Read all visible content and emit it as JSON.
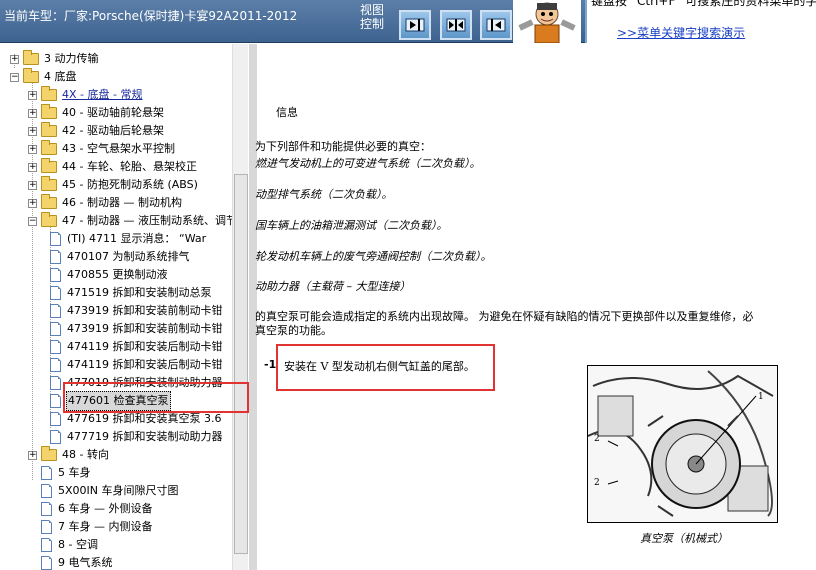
{
  "header": {
    "car_label": "当前车型：厂家:Porsche(保时捷)卡宴92A2011-2012",
    "view_control_label": "视图控制",
    "nav_buttons": [
      "show-tree",
      "split-view",
      "show-content"
    ]
  },
  "hint": {
    "text": "键盘按 “Ctrl+F” 可搜索庄的资料菜单的字！",
    "link": ">>菜单关键字搜索演示"
  },
  "tree": {
    "items": [
      {
        "label": "3 动力传输",
        "kind": "folder",
        "expander": "+"
      },
      {
        "label": "4 底盘",
        "kind": "folder",
        "expander": "−"
      },
      {
        "label": "4X - 底盘 - 常规",
        "kind": "folder",
        "expander": "+"
      },
      {
        "label": "40 - 驱动轴前轮悬架",
        "kind": "folder",
        "expander": "+"
      },
      {
        "label": "42 - 驱动轴后轮悬架",
        "kind": "folder",
        "expander": "+"
      },
      {
        "label": "43 - 空气悬架水平控制",
        "kind": "folder",
        "expander": "+"
      },
      {
        "label": "44 - 车轮、轮胎、悬架校正",
        "kind": "folder",
        "expander": "+"
      },
      {
        "label": "45 - 防抱死制动系统 (ABS)",
        "kind": "folder",
        "expander": "+"
      },
      {
        "label": "46 - 制动器 — 制动机构",
        "kind": "folder",
        "expander": "+"
      },
      {
        "label": "47 - 制动器 — 液压制动系统、调节",
        "kind": "folder",
        "expander": "−"
      },
      {
        "label": "(TI) 4711 显示消息： “War",
        "kind": "doc"
      },
      {
        "label": "470107 为制动系统排气",
        "kind": "doc"
      },
      {
        "label": "470855 更换制动液",
        "kind": "doc"
      },
      {
        "label": "471519 拆卸和安装制动总泵",
        "kind": "doc"
      },
      {
        "label": "473919 拆卸和安装前制动卡钳",
        "kind": "doc"
      },
      {
        "label": "473919 拆卸和安装前制动卡钳",
        "kind": "doc"
      },
      {
        "label": "474119 拆卸和安装后制动卡钳",
        "kind": "doc"
      },
      {
        "label": "474119 拆卸和安装后制动卡钳",
        "kind": "doc"
      },
      {
        "label": "477019 拆卸和安装制动助力器",
        "kind": "doc"
      },
      {
        "label": "477601 检查真空泵",
        "kind": "doc"
      },
      {
        "label": "477619 拆卸和安装真空泵 3.6",
        "kind": "doc"
      },
      {
        "label": "477719 拆卸和安装制动助力器",
        "kind": "doc"
      },
      {
        "label": "48 - 转向",
        "kind": "folder",
        "expander": "+"
      },
      {
        "label": "5 车身",
        "kind": "doc"
      },
      {
        "label": "5X00IN 车身间隙尺寸图",
        "kind": "doc"
      },
      {
        "label": "6 车身 — 外侧设备",
        "kind": "doc"
      },
      {
        "label": "7 车身 — 内侧设备",
        "kind": "doc"
      },
      {
        "label": "8 - 空调",
        "kind": "doc"
      },
      {
        "label": "9 电气系统",
        "kind": "doc"
      }
    ],
    "selected_index": 19,
    "link_index": 2
  },
  "content": {
    "heading": "信息",
    "intro": "为下列部件和功能提供必要的真空：",
    "items": [
      "燃进气发动机上的可变进气系统（二次负载）。",
      "动型排气系统（二次负载）。",
      "国车辆上的油箱泄漏测试（二次负载）。",
      "轮发动机车辆上的废气旁通阀控制（二次负载）。",
      "动助力器（主载荷 – 大型连接）"
    ],
    "warning_line1": "的真空泵可能会造成指定的系统内出现故障。 为避免在怀疑有缺陷的情况下更换部件以及重复维修，必",
    "warning_line2": "真空泵的功能。",
    "step_marker": "-1",
    "step_text": "安装在 V 型发动机右侧气缸盖的尾部。",
    "figure_caption": "真空泵（机械式）",
    "figure_callouts": [
      "1",
      "2",
      "2"
    ]
  }
}
